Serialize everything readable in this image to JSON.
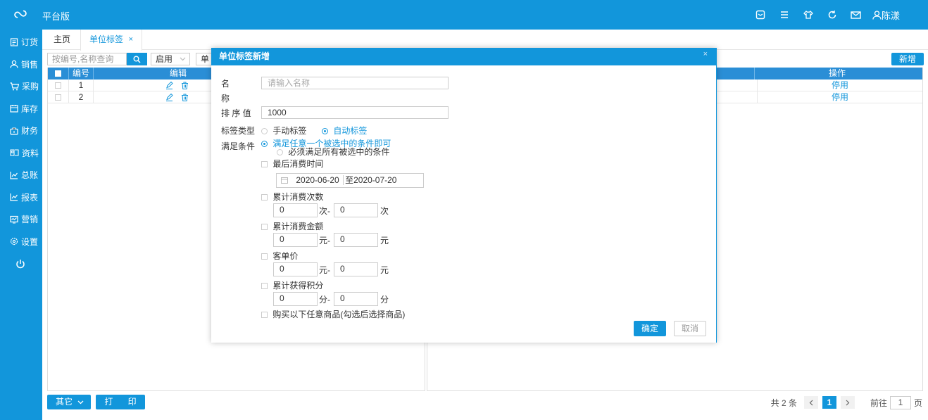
{
  "app": {
    "brand": "平台版",
    "user": "陈漾"
  },
  "sidebar": {
    "items": [
      {
        "label": "订货",
        "icon": "order-icon"
      },
      {
        "label": "销售",
        "icon": "sales-icon"
      },
      {
        "label": "采购",
        "icon": "cart-icon"
      },
      {
        "label": "库存",
        "icon": "inventory-icon"
      },
      {
        "label": "财务",
        "icon": "finance-icon"
      },
      {
        "label": "资料",
        "icon": "data-icon"
      },
      {
        "label": "总账",
        "icon": "ledger-icon"
      },
      {
        "label": "报表",
        "icon": "report-icon"
      },
      {
        "label": "营销",
        "icon": "marketing-icon"
      },
      {
        "label": "设置",
        "icon": "settings-icon"
      }
    ]
  },
  "tabs": {
    "home": "主页",
    "active": "单位标签",
    "close": "×"
  },
  "toolbar": {
    "search_placeholder": "按编号,名称查询",
    "status_select": "启用",
    "type_select": "单",
    "new_button": "新增"
  },
  "left_table": {
    "headers": {
      "no": "编号",
      "edit": "编辑"
    },
    "rows": [
      {
        "no": "1"
      },
      {
        "no": "2"
      }
    ]
  },
  "right_table": {
    "headers": {
      "op": "操作"
    },
    "rows": [
      {
        "op": "停用"
      },
      {
        "op": "停用"
      }
    ]
  },
  "bottom": {
    "other": "其它",
    "print": "打 印",
    "total": "共 2 条",
    "current_page": "1",
    "goto_label": "前往",
    "goto_value": "1",
    "page_unit": "页"
  },
  "modal": {
    "title": "单位标签新增",
    "close": "×",
    "name_label_1": "名",
    "name_label_2": "称",
    "name_placeholder": "请输入名称",
    "sort_label": "排 序 值",
    "sort_value": "1000",
    "type_label": "标签类型",
    "type_manual": "手动标签",
    "type_auto": "自动标签",
    "cond_label": "满足条件",
    "cond_any": "满足任意一个被选中的条件即可",
    "cond_all": "必须满足所有被选中的条件",
    "last_time": "最后消费时间",
    "date_from": "2020-06-20",
    "date_to_label": "至",
    "date_to": "2020-07-20",
    "cum_count": "累计消费次数",
    "count_from": "0",
    "count_sep": "次-",
    "count_to": "0",
    "count_unit": "次",
    "cum_amount": "累计消费金额",
    "amount_from": "0",
    "amount_sep": "元-",
    "amount_to": "0",
    "amount_unit": "元",
    "avg_price": "客单价",
    "avg_from": "0",
    "avg_sep": "元-",
    "avg_to": "0",
    "avg_unit": "元",
    "cum_points": "累计获得积分",
    "points_from": "0",
    "points_sep": "分-",
    "points_to": "0",
    "points_unit": "分",
    "buy_goods": "购买以下任意商品(勾选后选择商品)",
    "ok": "确定",
    "cancel": "取消"
  }
}
